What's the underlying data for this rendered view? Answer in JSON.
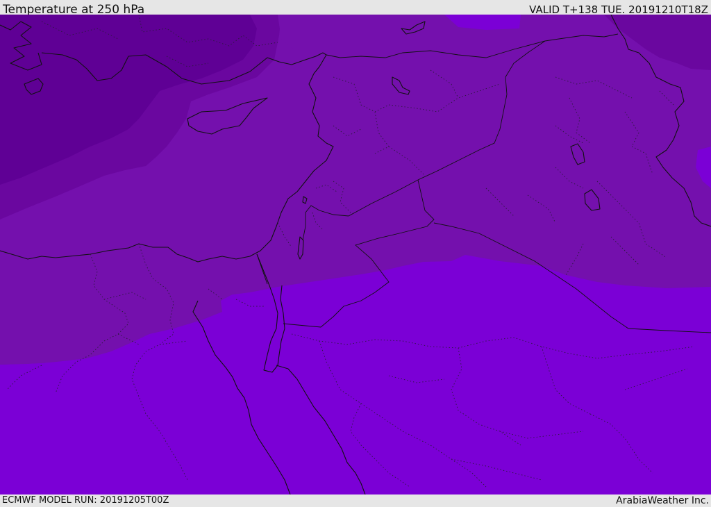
{
  "header": {
    "title": "Temperature at 250 hPa",
    "valid": "VALID T+138 TUE. 20191210T18Z"
  },
  "footer": {
    "model_run": "ECMWF MODEL RUN: 20191205T00Z",
    "credit": "ArabiaWeather Inc."
  },
  "colors": {
    "band_coldest": "#5f0095",
    "band_cold": "#6a079f",
    "band_mid": "#7410ad",
    "band_warm": "#7b00d6",
    "coastline": "#111111"
  }
}
